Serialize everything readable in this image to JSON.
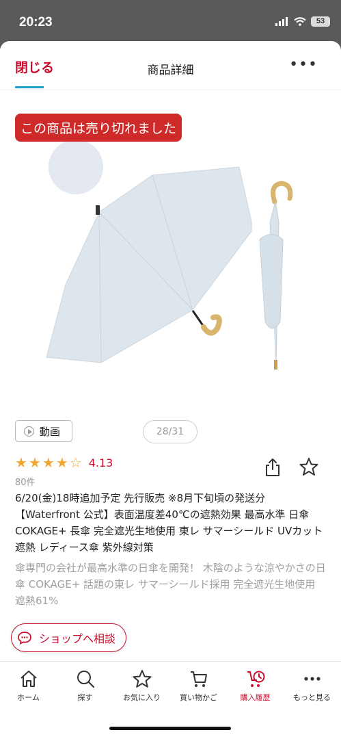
{
  "status": {
    "time": "20:23",
    "battery": "53"
  },
  "header": {
    "close_label": "閉じる",
    "title": "商品詳細",
    "more_label": "•••"
  },
  "product": {
    "soldout_label": "この商品は売り切れました",
    "video_label": "動画",
    "page_indicator": "28/31",
    "rating": 4.13,
    "rating_text": "4.13",
    "stars": [
      "full",
      "full",
      "full",
      "full",
      "empty"
    ],
    "review_count": "80件",
    "title": "6/20(金)18時追加予定 先行販売 ※8月下旬頃の発送分【Waterfront 公式】表面温度差40℃の遮熱効果 最高水準 日傘 COKAGE+ 長傘 完全遮光生地使用 東レ サマーシールド UVカット 遮熱 レディース傘 紫外線対策",
    "description": "傘専門の会社が最高水準の日傘を開発！ 木陰のような涼やかさの日傘 COKAGE+ 話題の東レ サマーシールド採用 完全遮光生地使用 遮熱61%",
    "shop_button": "ショップへ相談",
    "umbrella_color": "#dfe7ee",
    "handle_color": "#d8b56c"
  },
  "tabs": [
    {
      "label": "ホーム",
      "icon": "home-icon"
    },
    {
      "label": "探す",
      "icon": "search-icon"
    },
    {
      "label": "お気に入り",
      "icon": "star-icon"
    },
    {
      "label": "買い物かご",
      "icon": "cart-icon"
    },
    {
      "label": "購入履歴",
      "icon": "history-icon",
      "active": true
    },
    {
      "label": "もっと見る",
      "icon": "more-icon"
    }
  ],
  "colors": {
    "accent": "#c8102e",
    "link_underline": "#1fa0d0",
    "star": "#f0a830"
  }
}
